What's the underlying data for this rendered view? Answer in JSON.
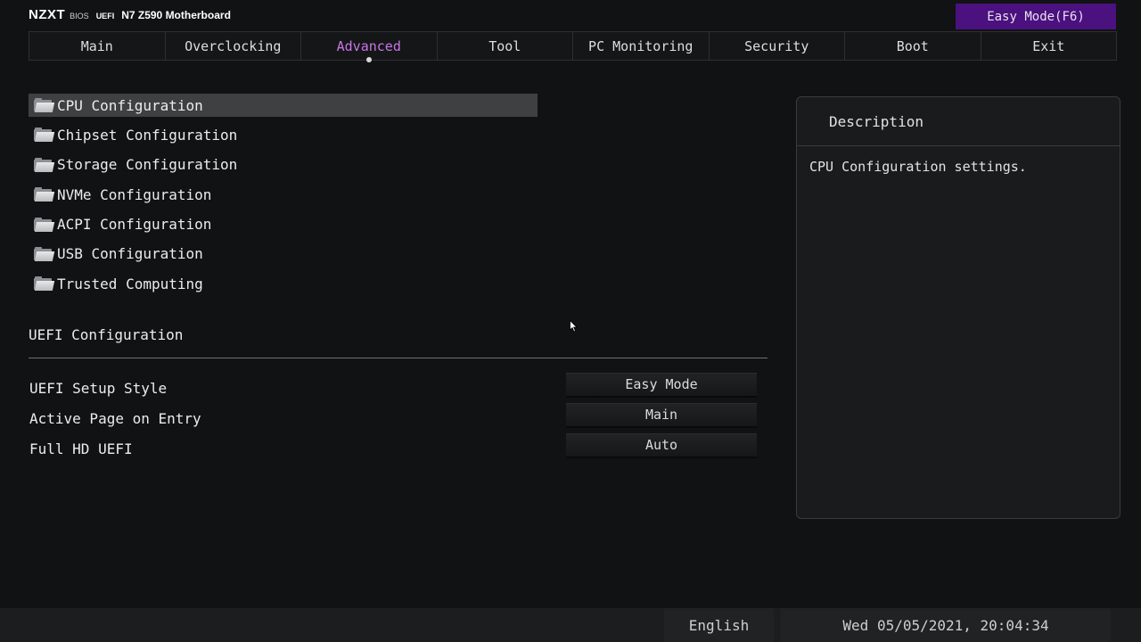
{
  "header": {
    "brand": "NZXT",
    "bios": "BIOS",
    "uefi": "UEFI",
    "model": "N7 Z590 Motherboard",
    "easy_mode_button": "Easy Mode(F6)"
  },
  "tabs": [
    {
      "label": "Main",
      "active": false
    },
    {
      "label": "Overclocking",
      "active": false
    },
    {
      "label": "Advanced",
      "active": true
    },
    {
      "label": "Tool",
      "active": false
    },
    {
      "label": "PC Monitoring",
      "active": false
    },
    {
      "label": "Security",
      "active": false
    },
    {
      "label": "Boot",
      "active": false
    },
    {
      "label": "Exit",
      "active": false
    }
  ],
  "menu": {
    "items": [
      {
        "label": "CPU Configuration",
        "selected": true
      },
      {
        "label": "Chipset Configuration",
        "selected": false
      },
      {
        "label": "Storage Configuration",
        "selected": false
      },
      {
        "label": "NVMe Configuration",
        "selected": false
      },
      {
        "label": "ACPI Configuration",
        "selected": false
      },
      {
        "label": "USB Configuration",
        "selected": false
      },
      {
        "label": "Trusted Computing",
        "selected": false
      }
    ]
  },
  "uefi_section": {
    "title": "UEFI Configuration",
    "settings": [
      {
        "label": "UEFI Setup Style",
        "value": "Easy Mode"
      },
      {
        "label": "Active Page on Entry",
        "value": "Main"
      },
      {
        "label": "Full HD UEFI",
        "value": "Auto"
      }
    ]
  },
  "description": {
    "title": "Description",
    "text": "CPU Configuration settings."
  },
  "footer": {
    "language": "English",
    "datetime": "Wed 05/05/2021, 20:04:34"
  },
  "colors": {
    "accent": "#c776e8",
    "easy_mode_bg": "#4b117e",
    "background": "#111213"
  }
}
